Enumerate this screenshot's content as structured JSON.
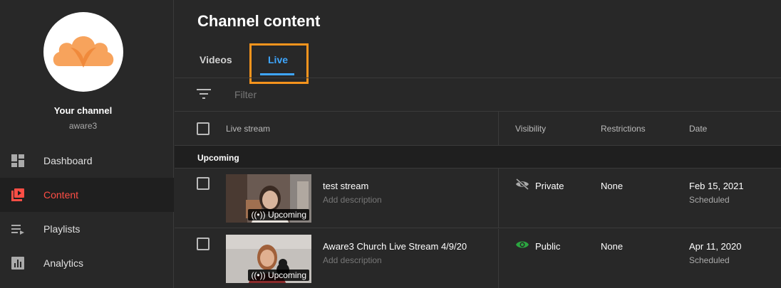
{
  "sidebar": {
    "channel_title": "Your channel",
    "channel_handle": "aware3",
    "logo": "aware3-logo",
    "items": [
      {
        "label": "Dashboard",
        "icon": "dashboard-icon",
        "active": false
      },
      {
        "label": "Content",
        "icon": "content-icon",
        "active": true
      },
      {
        "label": "Playlists",
        "icon": "playlists-icon",
        "active": false
      },
      {
        "label": "Analytics",
        "icon": "analytics-icon",
        "active": false
      }
    ]
  },
  "main": {
    "title": "Channel content",
    "tabs": [
      {
        "label": "Videos",
        "active": false
      },
      {
        "label": "Live",
        "active": true
      }
    ],
    "filter": {
      "placeholder": "Filter",
      "icon": "filter-icon"
    },
    "columns": [
      "Live stream",
      "Visibility",
      "Restrictions",
      "Date"
    ],
    "section": "Upcoming",
    "rows": [
      {
        "title": "test stream",
        "description": "Add description",
        "badge": "Upcoming",
        "visibility": "Private",
        "visibility_icon": "eye-off-icon",
        "restrictions": "None",
        "date": "Feb 15, 2021",
        "date_status": "Scheduled"
      },
      {
        "title": "Aware3 Church Live Stream 4/9/20",
        "description": "Add description",
        "badge": "Upcoming",
        "visibility": "Public",
        "visibility_icon": "eye-icon",
        "restrictions": "None",
        "date": "Apr 11, 2020",
        "date_status": "Scheduled"
      }
    ]
  },
  "colors": {
    "accent_blue": "#3ea6ff",
    "active_red": "#ff4e45",
    "highlight_orange": "#f7941d",
    "public_green": "#2ba640",
    "logo_orange": "#f7a35c"
  }
}
